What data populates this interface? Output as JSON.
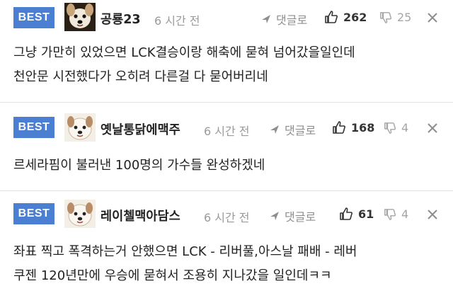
{
  "comments": [
    {
      "badge": "BEST",
      "nickname": "공룡23",
      "time": "6 시간 전",
      "reply_label": "댓글로",
      "likes": "262",
      "dislikes": "25",
      "lines": [
        "그냥 가만히 있었으면 LCK결승이랑 해축에 묻혀 넘어갔을일인데",
        "천안문 시전했다가 오히려 다른걸 다 묻어버리네"
      ]
    },
    {
      "badge": "BEST",
      "nickname": "옛날통닭에맥주",
      "time": "6 시간 전",
      "reply_label": "댓글로",
      "likes": "168",
      "dislikes": "4",
      "lines": [
        "르세라핌이 불러낸 100명의 가수들 완성하겠네"
      ]
    },
    {
      "badge": "BEST",
      "nickname": "레이첼맥아담스",
      "time": "6 시간 전",
      "reply_label": "댓글로",
      "likes": "61",
      "dislikes": "4",
      "lines": [
        "좌표 찍고 폭격하는거 안했으면 LCK - 리버풀,아스날 패배 - 레버",
        "쿠젠 120년만에 우승에 묻혀서 조용히 지나갔을 일인데ㅋㅋ"
      ]
    }
  ],
  "colors": {
    "best_badge": "#4a7fd1",
    "muted_text": "#9a9a9a",
    "separator": "#e2e2e2"
  },
  "icons": {
    "avatar": "dog-avatar-icon",
    "reply": "reply-arrow-icon",
    "like": "thumbs-up-icon",
    "dislike": "thumbs-down-icon",
    "more": "close-x-icon"
  }
}
